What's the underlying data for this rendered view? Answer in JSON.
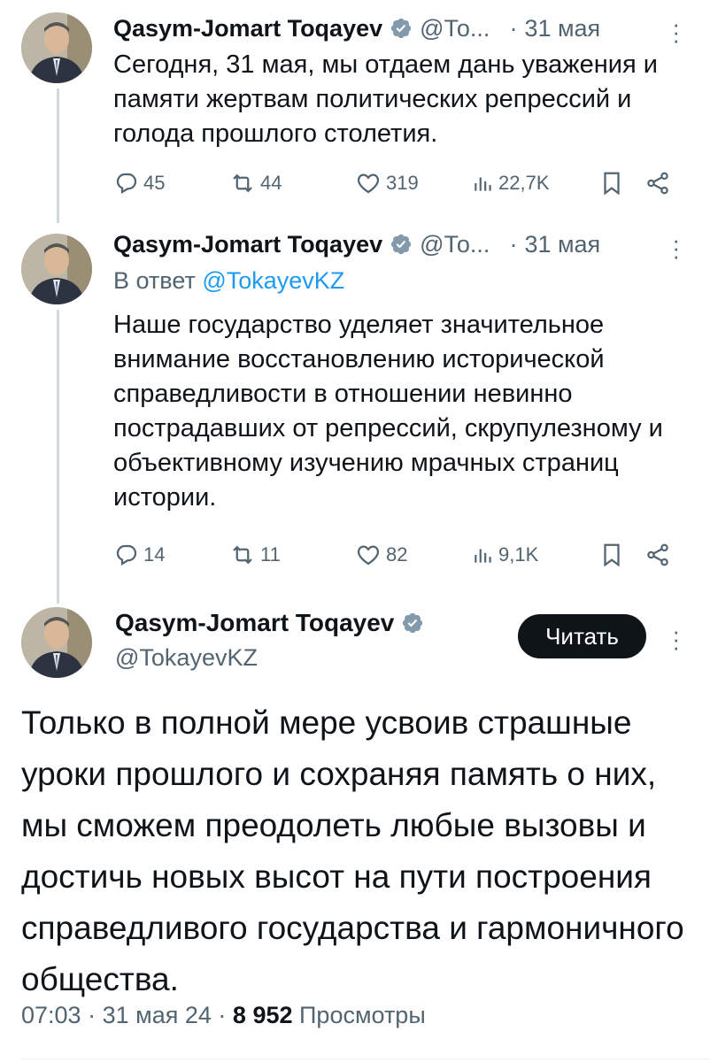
{
  "tweets": [
    {
      "author": "Qasym-Jomart Toqayev",
      "handle_truncated": "@То...",
      "date": "31 мая",
      "text": "Сегодня, 31 мая, мы отдаем дань уважения и памяти жертвам политических репрессий и голода прошлого столетия.",
      "replies": "45",
      "reposts": "44",
      "likes": "319",
      "views": "22,7K"
    },
    {
      "author": "Qasym-Jomart Toqayev",
      "handle_truncated": "@То...",
      "date": "31 мая",
      "reply_prefix": "В ответ",
      "reply_mention": "@TokayevKZ",
      "text": "Наше государство уделяет значительное внимание восстановлению исторической справедливости в отношении невинно пострадавших от репрессий, скрупулезному и объективному изучению мрачных страниц истории.",
      "replies": "14",
      "reposts": "11",
      "likes": "82",
      "views": "9,1K"
    }
  ],
  "main_tweet": {
    "author": "Qasym-Jomart Toqayev",
    "handle": "@TokayevKZ",
    "follow_button": "Читать",
    "text": "Только в полной мере усвоив страшные уроки прошлого и сохраняя память о них, мы сможем преодолеть любые вызовы и достичь новых высот на пути построения справедливого государства и гармоничного общества.",
    "time": "07:03",
    "date": "31 мая 24",
    "separator": "·",
    "views_count": "8 952",
    "views_label": "Просмотры"
  },
  "colors": {
    "text": "#0f1419",
    "secondary": "#536471",
    "link": "#1d9bf0",
    "verified_badge": "#829aab",
    "thread_line": "#cfd9de"
  }
}
